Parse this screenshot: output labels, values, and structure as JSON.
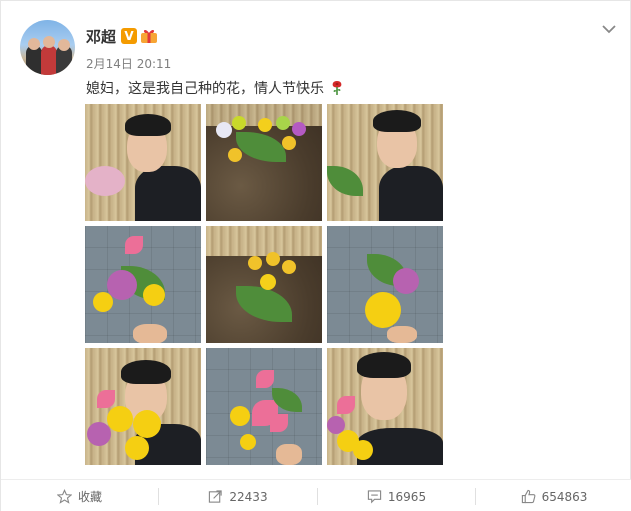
{
  "post": {
    "username": "邓超",
    "verified_badge": "V",
    "timestamp": "2月14日 20:11",
    "text": "媳妇，这是我自己种的花，情人节快乐",
    "text_emoji": "rose-icon"
  },
  "photos": [
    {
      "scene": "selfie-bamboo"
    },
    {
      "scene": "flowers-soil"
    },
    {
      "scene": "selfie-bamboo-2"
    },
    {
      "scene": "bouquet-paving"
    },
    {
      "scene": "plant-soil"
    },
    {
      "scene": "bouquet-paving-2"
    },
    {
      "scene": "selfie-bouquet"
    },
    {
      "scene": "bouquet-lily"
    },
    {
      "scene": "selfie-bouquet-smile"
    }
  ],
  "actions": {
    "favorite_label": "收藏",
    "repost_count": "22433",
    "comment_count": "16965",
    "like_count": "654863"
  },
  "colors": {
    "verified": "#f49b00",
    "text": "#333333",
    "meta": "#808080"
  }
}
